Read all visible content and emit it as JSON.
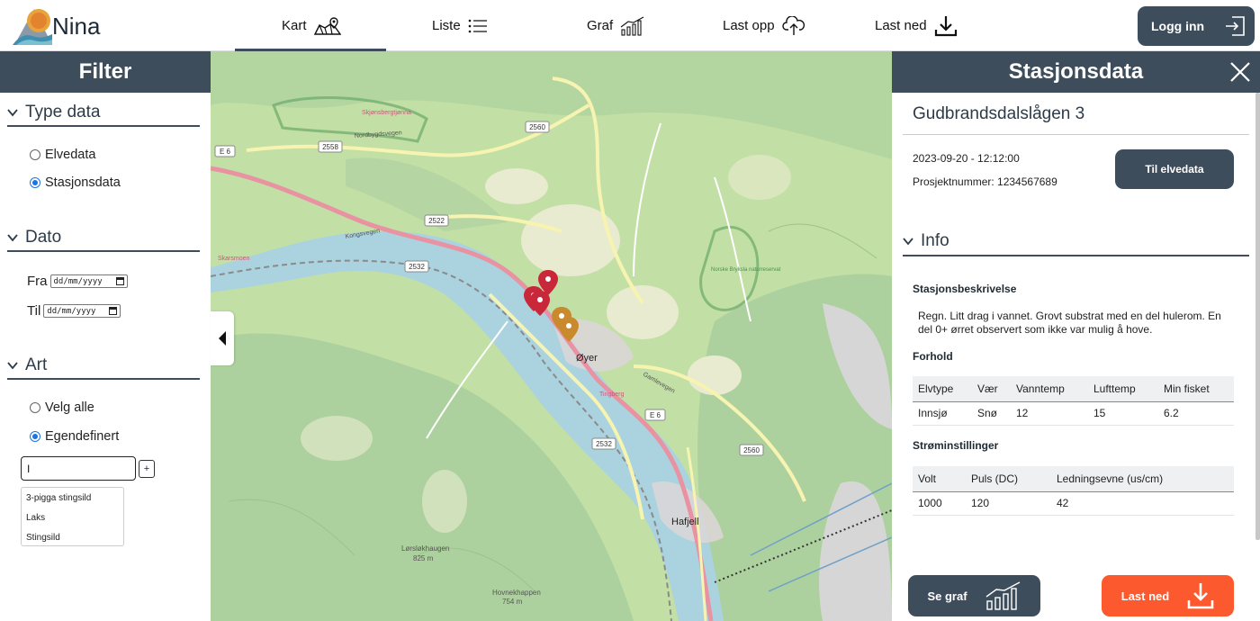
{
  "brand": {
    "name": "Nina",
    "icon": "nina-logo-icon"
  },
  "nav": {
    "map": {
      "label": "Kart",
      "icon": "map-icon",
      "active": true
    },
    "list": {
      "label": "Liste",
      "icon": "list-icon"
    },
    "graph": {
      "label": "Graf",
      "icon": "bar-chart-icon"
    },
    "upload": {
      "label": "Last opp",
      "icon": "cloud-upload-icon"
    },
    "download": {
      "label": "Last ned",
      "icon": "download-icon"
    },
    "login": {
      "label": "Logg inn",
      "icon": "login-icon"
    }
  },
  "filter": {
    "title": "Filter",
    "type_data": {
      "heading": "Type data",
      "options": [
        {
          "label": "Elvedata",
          "selected": false
        },
        {
          "label": "Stasjonsdata",
          "selected": true
        }
      ]
    },
    "date": {
      "heading": "Dato",
      "from_label": "Fra",
      "to_label": "Til",
      "placeholder": "dd/mm/yyyy"
    },
    "species": {
      "heading": "Art",
      "options": [
        {
          "label": "Velg alle",
          "selected": false
        },
        {
          "label": "Egendefinert",
          "selected": true
        }
      ],
      "input_value": "I",
      "add_label": "+",
      "suggestions": [
        "3-pigga stingsild",
        "Laks",
        "Stingsild"
      ]
    }
  },
  "map": {
    "place_labels": [
      "Øyer",
      "Hafjell",
      "Lørsløkhaugen",
      "825 m",
      "Hovnekhappen",
      "754 m",
      "Skjønsbergtjønna",
      "Skarsmoen",
      "Norske Bryksla naturreservat",
      "Tingberg"
    ],
    "road_labels": [
      "E 6",
      "2558",
      "2560",
      "2522",
      "2532",
      "Nordbygdsvegen",
      "Kongsvegen",
      "Gamlevegen"
    ],
    "marker_colors": {
      "red": "#c8283a",
      "orange": "#c98a2e"
    }
  },
  "station": {
    "panel_title": "Stasjonsdata",
    "name": "Gudbrandsdalslågen 3",
    "datetime": "2023-09-20 - 12:12:00",
    "project": "Prosjektnummer: 1234567689",
    "river_button": "Til elvedata",
    "info_heading": "Info",
    "description_label": "Stasjonsbeskrivelse",
    "description": "Regn. Litt drag i vannet. Grovt substrat med en del hulerom. En del 0+ ørret observert som ikke var mulig å hove.",
    "conditions_label": "Forhold",
    "conditions": {
      "headers": [
        "Elvtype",
        "Vær",
        "Vanntemp",
        "Lufttemp",
        "Min fisket"
      ],
      "rows": [
        [
          "Innsjø",
          "Snø",
          "12",
          "15",
          "6.2"
        ]
      ]
    },
    "current_label": "Strøminstillinger",
    "current": {
      "headers": [
        "Volt",
        "Puls (DC)",
        "Ledningsevne (us/cm)"
      ],
      "rows": [
        [
          "1000",
          "120",
          "42"
        ]
      ]
    },
    "graph_button": "Se graf",
    "download_button": "Last ned"
  },
  "colors": {
    "header": "#3e4d5c",
    "accent": "#fc5a2e",
    "water": "#aad3df",
    "forest": "#add19e"
  }
}
